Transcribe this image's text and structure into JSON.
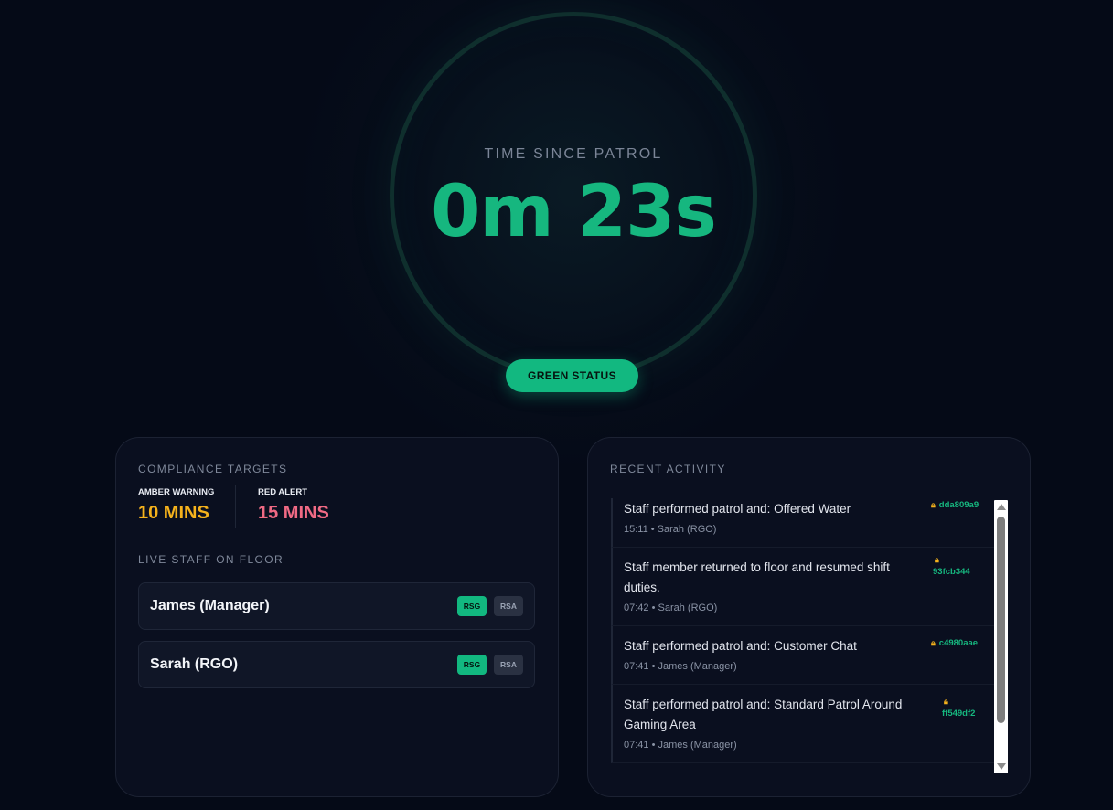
{
  "timer": {
    "label": "TIME SINCE PATROL",
    "value": "0m 23s"
  },
  "status": {
    "label": "GREEN STATUS",
    "color": "#12b880"
  },
  "compliance": {
    "title": "COMPLIANCE TARGETS",
    "amber_label": "AMBER WARNING",
    "amber_value": "10 MINS",
    "red_label": "RED ALERT",
    "red_value": "15 MINS"
  },
  "staff": {
    "title": "LIVE STAFF ON FLOOR",
    "members": [
      {
        "name": "James (Manager)",
        "badges": [
          "RSG",
          "RSA"
        ]
      },
      {
        "name": "Sarah (RGO)",
        "badges": [
          "RSG",
          "RSA"
        ]
      }
    ]
  },
  "activity": {
    "title": "RECENT ACTIVITY",
    "items": [
      {
        "text": "Staff performed patrol and: Offered Water",
        "meta": "15:11 • Sarah (RGO)",
        "hash": "dda809a9"
      },
      {
        "text": "Staff member returned to floor and resumed shift duties.",
        "meta": "07:42 • Sarah (RGO)",
        "hash": "93fcb344"
      },
      {
        "text": "Staff performed patrol and: Customer Chat",
        "meta": "07:41 • James (Manager)",
        "hash": "c4980aae"
      },
      {
        "text": "Staff performed patrol and: Standard Patrol Around Gaming Area",
        "meta": "07:41 • James (Manager)",
        "hash": "ff549df2"
      }
    ]
  },
  "colors": {
    "accent": "#16b77f",
    "amber": "#f5b21c",
    "red": "#f06a84",
    "background": "#050a17"
  },
  "icons": {
    "lock": "lock-icon"
  }
}
